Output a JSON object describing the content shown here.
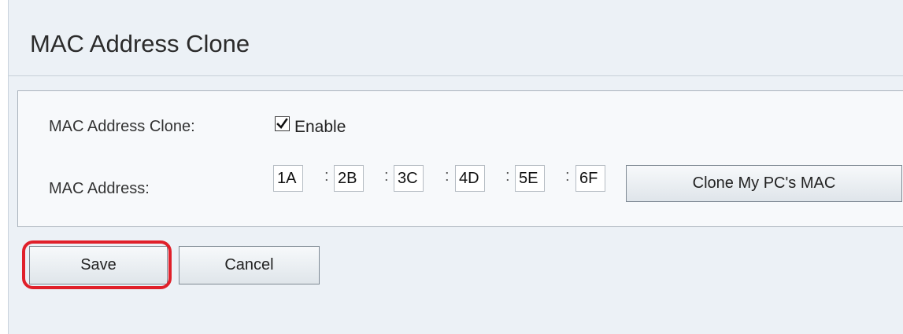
{
  "page": {
    "title": "MAC Address Clone"
  },
  "form": {
    "clone_label": "MAC Address Clone:",
    "enable_checked": true,
    "enable_label": "Enable",
    "mac_label": "MAC Address:",
    "mac_octets": [
      "1A",
      "2B",
      "3C",
      "4D",
      "5E",
      "6F"
    ],
    "separator": ":",
    "clone_button_label": "Clone My PC's MAC"
  },
  "actions": {
    "save_label": "Save",
    "cancel_label": "Cancel"
  },
  "annotation": {
    "highlight_color": "#e0202a",
    "highlighted_element": "save-button"
  },
  "icons": {
    "checkbox": "checkmark-icon"
  }
}
